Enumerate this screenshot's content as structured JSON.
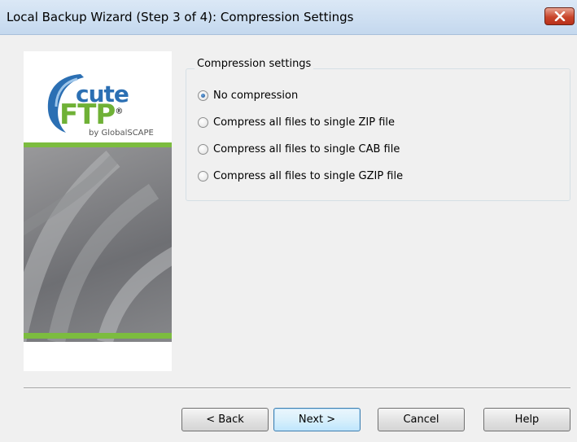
{
  "window": {
    "title": "Local Backup Wizard (Step 3 of 4): Compression Settings"
  },
  "banner": {
    "logo_line1": "cute",
    "logo_line2": "FTP",
    "logo_trademark": "®",
    "byline": "by GlobalSCAPE"
  },
  "compression": {
    "group_label": "Compression settings",
    "options": [
      {
        "label": "No compression",
        "checked": true
      },
      {
        "label": "Compress all files to single ZIP file",
        "checked": false
      },
      {
        "label": "Compress all files to single CAB file",
        "checked": false
      },
      {
        "label": "Compress all files to single GZIP file",
        "checked": false
      }
    ]
  },
  "buttons": {
    "back": "< Back",
    "next": "Next >",
    "cancel": "Cancel",
    "help": "Help"
  },
  "colors": {
    "accent_green": "#7cbc3f",
    "logo_blue": "#2b6fb3",
    "close_red": "#c9452b"
  }
}
